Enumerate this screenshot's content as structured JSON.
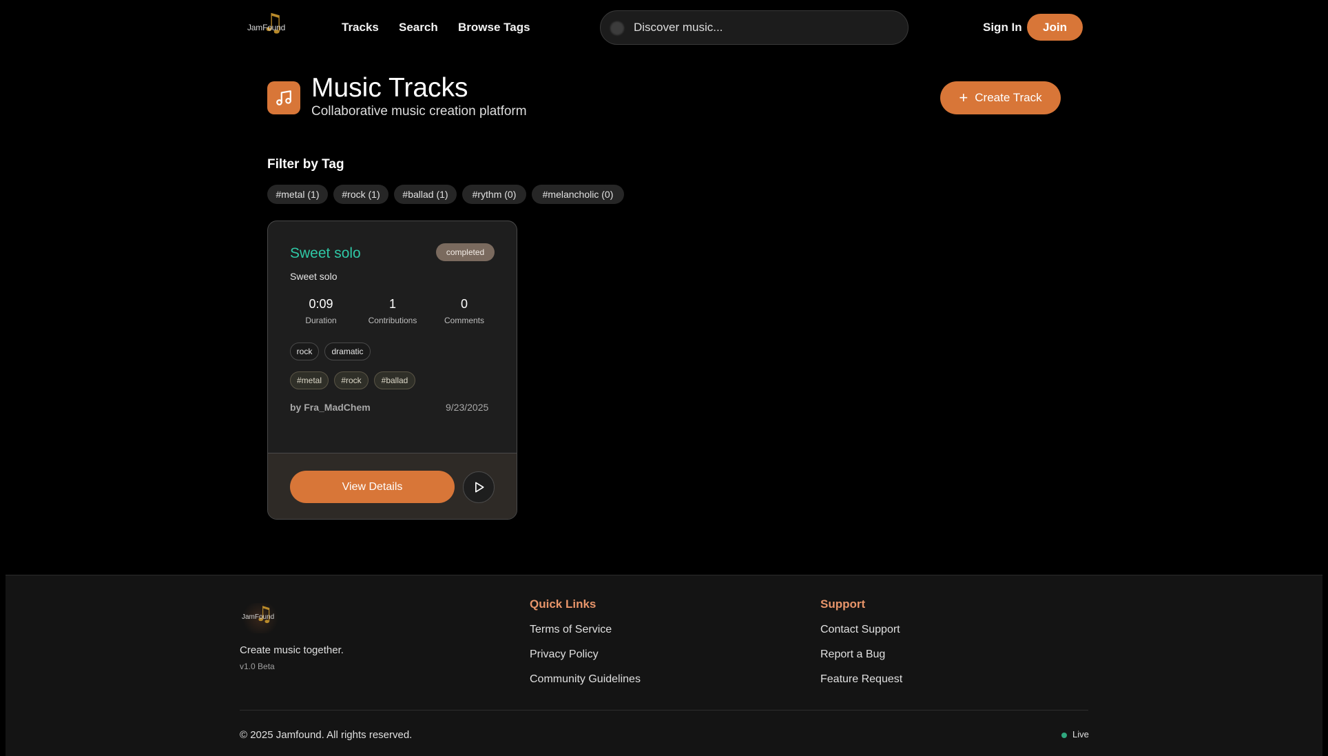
{
  "header": {
    "logo_text": "JamFound",
    "nav": [
      "Tracks",
      "Search",
      "Browse Tags"
    ],
    "search_placeholder": "Discover music...",
    "sign_in": "Sign In",
    "join": "Join"
  },
  "page": {
    "title": "Music Tracks",
    "subtitle": "Collaborative music creation platform",
    "create_button": "Create Track",
    "accent_color": "#d87638"
  },
  "filter": {
    "title": "Filter by Tag",
    "tags": [
      "#metal (1)",
      "#rock (1)",
      "#ballad (1)",
      "#rythm (0)",
      "#melancholic (0)"
    ]
  },
  "track": {
    "title": "Sweet solo",
    "status": "completed",
    "description": "Sweet solo",
    "stats": [
      {
        "value": "0:09",
        "label": "Duration"
      },
      {
        "value": "1",
        "label": "Contributions"
      },
      {
        "value": "0",
        "label": "Comments"
      }
    ],
    "genres": [
      "rock",
      "dramatic"
    ],
    "hashtags": [
      "#metal",
      "#rock",
      "#ballad"
    ],
    "author": "by Fra_MadChem",
    "date": "9/23/2025",
    "view_button": "View Details",
    "title_color": "#2fc8a6"
  },
  "footer": {
    "logo_text": "JamFound",
    "tagline": "Create music together.",
    "version": "v1.0 Beta",
    "quick_links_title": "Quick Links",
    "quick_links": [
      "Terms of Service",
      "Privacy Policy",
      "Community Guidelines"
    ],
    "support_title": "Support",
    "support_links": [
      "Contact Support",
      "Report a Bug",
      "Feature Request"
    ],
    "copyright": "© 2025 Jamfound. All rights reserved.",
    "status": "Live"
  }
}
